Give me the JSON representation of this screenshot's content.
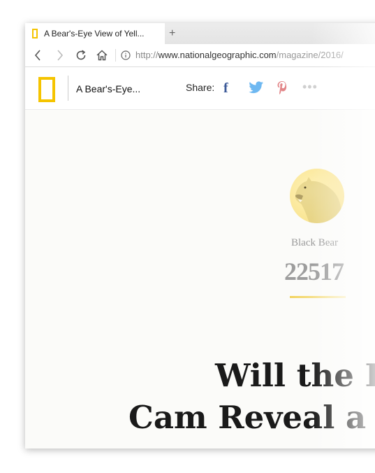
{
  "browser": {
    "tab_title": "A Bear's-Eye View of Yell...",
    "new_tab": "+",
    "url_scheme": "http://",
    "url_host": "www.nationalgeographic.com",
    "url_path": "/magazine/2016/"
  },
  "site_header": {
    "article_title": "A Bear's-Eye...",
    "share_label": "Share:",
    "share_more": "•••"
  },
  "counter": {
    "label": "Black Bear",
    "value": "22517"
  },
  "headline": {
    "line1": "Will the B",
    "line2": "Cam Reveal a C"
  },
  "colors": {
    "brand_yellow": "#f5c400",
    "facebook": "#3b5998",
    "twitter": "#55acee",
    "pinterest": "#cb2027"
  },
  "icons": [
    "back-icon",
    "forward-icon",
    "reload-icon",
    "home-icon",
    "info-icon",
    "facebook-icon",
    "twitter-icon",
    "pinterest-icon",
    "more-icon",
    "bear-icon"
  ]
}
